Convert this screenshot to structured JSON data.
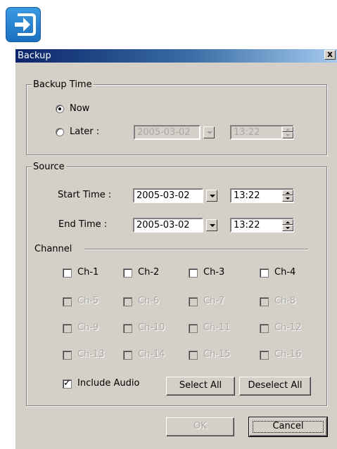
{
  "app_icon": "import-arrow-icon",
  "window": {
    "title": "Backup",
    "close_label": "x"
  },
  "backup_time": {
    "legend": "Backup Time",
    "now_label": "Now",
    "later_label": "Later :",
    "selected": "Now",
    "later_date": "2005-03-02",
    "later_time": "13:22"
  },
  "source": {
    "legend": "Source",
    "start_label": "Start Time :",
    "start_date": "2005-03-02",
    "start_time": "13:22",
    "end_label": "End Time :",
    "end_date": "2005-03-02",
    "end_time": "13:22",
    "channel_label": "Channel",
    "channels": [
      {
        "label": "Ch-1",
        "enabled": true,
        "checked": false
      },
      {
        "label": "Ch-2",
        "enabled": true,
        "checked": false
      },
      {
        "label": "Ch-3",
        "enabled": true,
        "checked": false
      },
      {
        "label": "Ch-4",
        "enabled": true,
        "checked": false
      },
      {
        "label": "Ch-5",
        "enabled": false,
        "checked": false
      },
      {
        "label": "Ch-6",
        "enabled": false,
        "checked": false
      },
      {
        "label": "Ch-7",
        "enabled": false,
        "checked": false
      },
      {
        "label": "Ch-8",
        "enabled": false,
        "checked": false
      },
      {
        "label": "Ch-9",
        "enabled": false,
        "checked": false
      },
      {
        "label": "Ch-10",
        "enabled": false,
        "checked": false
      },
      {
        "label": "Ch-11",
        "enabled": false,
        "checked": false
      },
      {
        "label": "Ch-12",
        "enabled": false,
        "checked": false
      },
      {
        "label": "Ch-13",
        "enabled": false,
        "checked": false
      },
      {
        "label": "Ch-14",
        "enabled": false,
        "checked": false
      },
      {
        "label": "Ch-15",
        "enabled": false,
        "checked": false
      },
      {
        "label": "Ch-16",
        "enabled": false,
        "checked": false
      }
    ],
    "include_audio_label": "Include Audio",
    "include_audio_checked": true,
    "select_all_label": "Select All",
    "deselect_all_label": "Deselect All"
  },
  "footer": {
    "ok_label": "OK",
    "cancel_label": "Cancel"
  },
  "colors": {
    "title_bar_start": "#0a246a",
    "title_bar_end": "#a6caf0",
    "dialog_face": "#d4d0c8",
    "app_icon_blue": "#1c6fc0"
  }
}
